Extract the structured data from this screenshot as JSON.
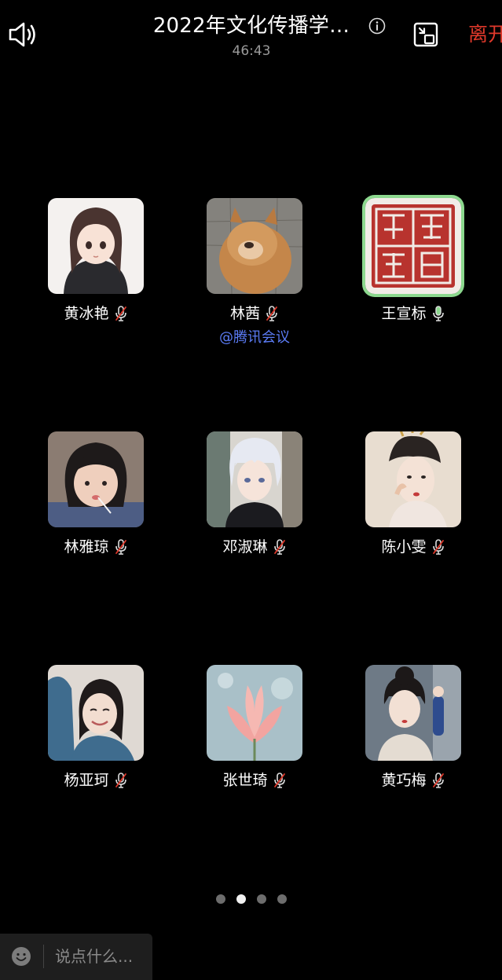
{
  "header": {
    "title": "2022年文化传播学…",
    "timer": "46:43",
    "leave_label": "离开"
  },
  "participants": [
    {
      "name": "黄冰艳",
      "mic": "muted"
    },
    {
      "name": "林茜",
      "mic": "muted",
      "tag": "@腾讯会议"
    },
    {
      "name": "王宣标",
      "mic": "on",
      "speaking": true
    },
    {
      "name": "林雅琼",
      "mic": "muted"
    },
    {
      "name": "邓淑琳",
      "mic": "muted"
    },
    {
      "name": "陈小雯",
      "mic": "muted"
    },
    {
      "name": "杨亚珂",
      "mic": "muted"
    },
    {
      "name": "张世琦",
      "mic": "muted"
    },
    {
      "name": "黄巧梅",
      "mic": "muted"
    }
  ],
  "pager": {
    "total": 4,
    "current": 2
  },
  "chat": {
    "placeholder": "说点什么..."
  },
  "colors": {
    "leave": "#e0392b",
    "host_tag": "#5b7cf6",
    "speaking_ring": "#8cd88e",
    "mic_muted": "#e0392b"
  }
}
